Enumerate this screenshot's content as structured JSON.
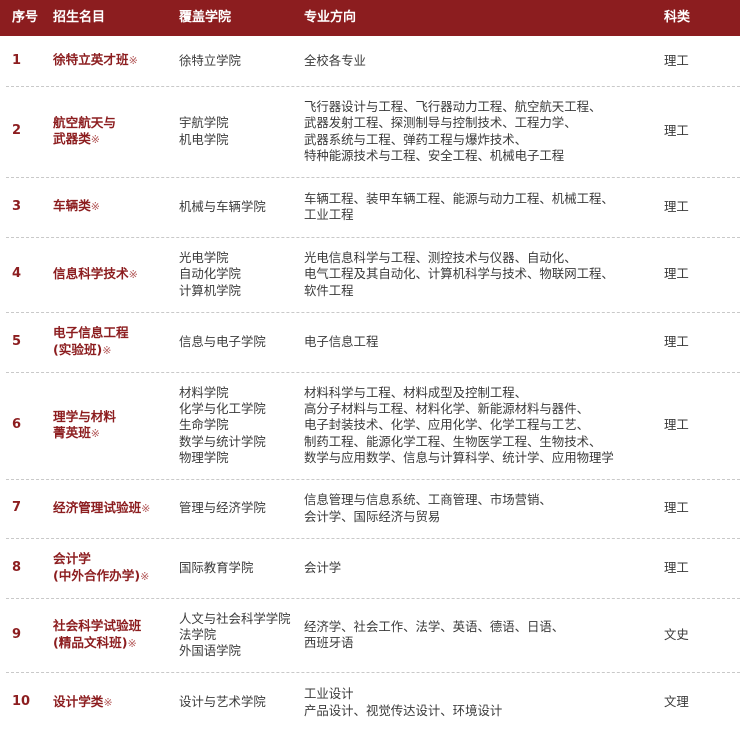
{
  "table": {
    "headers": {
      "num": "序号",
      "name": "招生名目",
      "college": "覆盖学院",
      "major": "专业方向",
      "category": "科类"
    },
    "mark": "※",
    "rows": [
      {
        "num": "1",
        "name": [
          "徐特立英才班"
        ],
        "colleges": [
          "徐特立学院"
        ],
        "majors": [
          "全校各专业"
        ],
        "category": "理工"
      },
      {
        "num": "2",
        "name": [
          "航空航天与",
          "武器类"
        ],
        "colleges": [
          "宇航学院",
          "机电学院"
        ],
        "majors": [
          "飞行器设计与工程、飞行器动力工程、航空航天工程、",
          "武器发射工程、探测制导与控制技术、工程力学、",
          "武器系统与工程、弹药工程与爆炸技术、",
          "特种能源技术与工程、安全工程、机械电子工程"
        ],
        "category": "理工"
      },
      {
        "num": "3",
        "name": [
          "车辆类"
        ],
        "colleges": [
          "机械与车辆学院"
        ],
        "majors": [
          "车辆工程、装甲车辆工程、能源与动力工程、机械工程、",
          "工业工程"
        ],
        "category": "理工"
      },
      {
        "num": "4",
        "name": [
          "信息科学技术"
        ],
        "colleges": [
          "光电学院",
          "自动化学院",
          "计算机学院"
        ],
        "majors": [
          "光电信息科学与工程、测控技术与仪器、自动化、",
          "电气工程及其自动化、计算机科学与技术、物联网工程、",
          "软件工程"
        ],
        "category": "理工"
      },
      {
        "num": "5",
        "name": [
          "电子信息工程",
          "(实验班)"
        ],
        "colleges": [
          "信息与电子学院"
        ],
        "majors": [
          "电子信息工程"
        ],
        "category": "理工"
      },
      {
        "num": "6",
        "name": [
          "理学与材料",
          "菁英班"
        ],
        "colleges": [
          "材料学院",
          "化学与化工学院",
          "生命学院",
          "数学与统计学院",
          "物理学院"
        ],
        "majors": [
          "材料科学与工程、材料成型及控制工程、",
          "高分子材料与工程、材料化学、新能源材料与器件、",
          "电子封装技术、化学、应用化学、化学工程与工艺、",
          "制药工程、能源化学工程、生物医学工程、生物技术、",
          "数学与应用数学、信息与计算科学、统计学、应用物理学"
        ],
        "category": "理工"
      },
      {
        "num": "7",
        "name": [
          "经济管理试验班"
        ],
        "colleges": [
          "管理与经济学院"
        ],
        "majors": [
          "信息管理与信息系统、工商管理、市场营销、",
          "会计学、国际经济与贸易"
        ],
        "category": "理工"
      },
      {
        "num": "8",
        "name": [
          "会计学",
          "(中外合作办学)"
        ],
        "colleges": [
          "国际教育学院"
        ],
        "majors": [
          "会计学"
        ],
        "category": "理工"
      },
      {
        "num": "9",
        "name": [
          "社会科学试验班",
          "(精品文科班)"
        ],
        "colleges": [
          "人文与社会科学学院",
          "法学院",
          "外国语学院"
        ],
        "majors": [
          "经济学、社会工作、法学、英语、德语、日语、",
          "西班牙语"
        ],
        "category": "文史"
      },
      {
        "num": "10",
        "name": [
          "设计学类"
        ],
        "colleges": [
          "设计与艺术学院"
        ],
        "majors": [
          "工业设计",
          "产品设计、视觉传达设计、环境设计"
        ],
        "category": "文理"
      }
    ]
  }
}
